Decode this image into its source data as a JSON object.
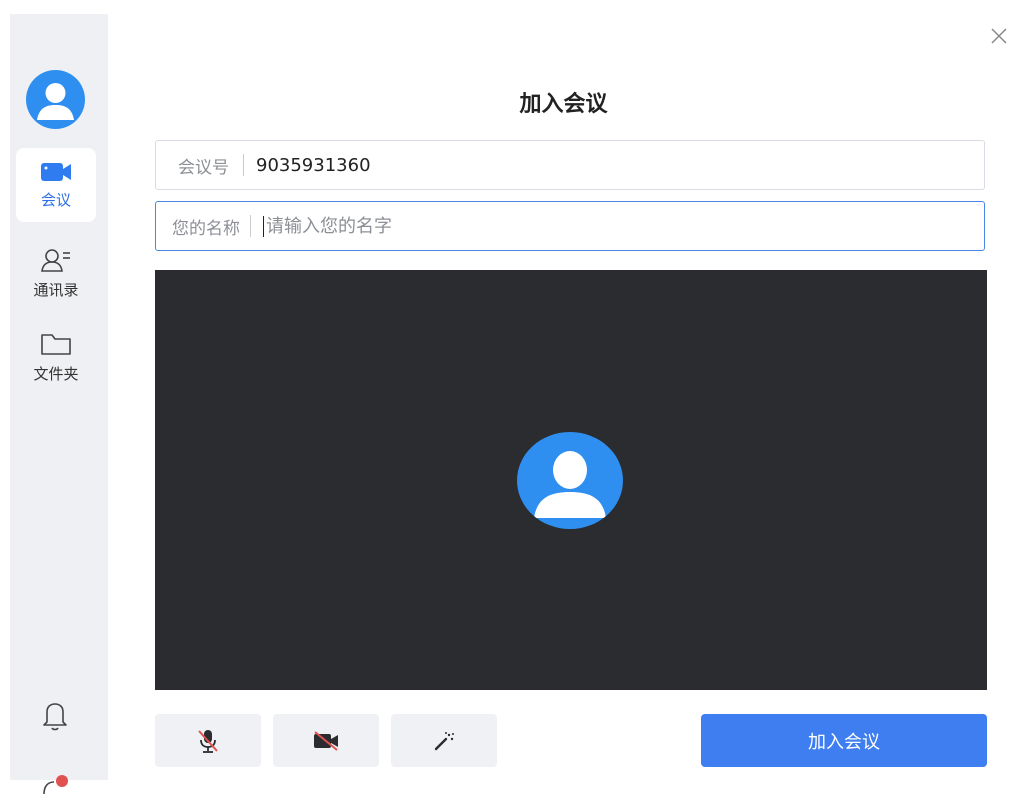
{
  "sidebar": {
    "items": [
      {
        "label": "会议",
        "icon": "video-camera-icon",
        "active": true
      },
      {
        "label": "通讯录",
        "icon": "contacts-icon",
        "active": false
      },
      {
        "label": "文件夹",
        "icon": "folder-icon",
        "active": false
      }
    ]
  },
  "dialog": {
    "title": "加入会议",
    "meeting_id_label": "会议号",
    "meeting_id_value": "9035931360",
    "name_label": "您的名称",
    "name_placeholder": "请输入您的名字",
    "join_label": "加入会议"
  },
  "colors": {
    "accent": "#3e7ef0",
    "preview_bg": "#2b2c2f",
    "sidebar_bg": "#eef0f3",
    "muted_red": "#e0524f"
  }
}
